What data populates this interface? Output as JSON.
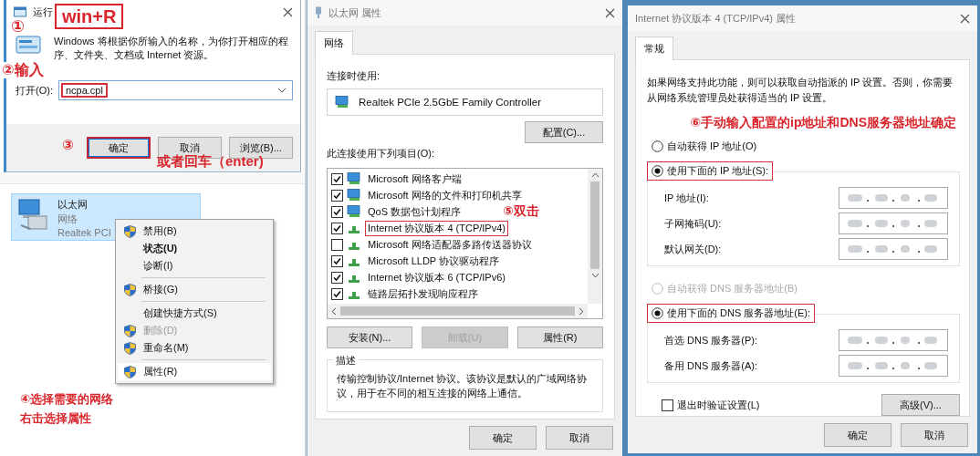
{
  "run_dialog": {
    "title": "运行",
    "description": "Windows 将根据你所输入的名称，为你打开相应的程序、文件夹、文档或 Internet 资源。",
    "open_label": "打开(O):",
    "open_value": "ncpa.cpl",
    "value_highlighted": true,
    "buttons": [
      {
        "label": "确定",
        "highlighted": true
      },
      {
        "label": "取消",
        "highlighted": false
      },
      {
        "label": "浏览(B)...",
        "highlighted": false
      }
    ]
  },
  "network_connection": {
    "name": "以太网",
    "type": "网络",
    "adapter": "Realtek PCI",
    "selected": true
  },
  "context_menu": [
    {
      "kind": "shield",
      "label": "禁用(B)",
      "bold": false,
      "disabled": false,
      "selected": false
    },
    {
      "kind": "plain",
      "label": "状态(U)",
      "bold": true,
      "disabled": false,
      "selected": false
    },
    {
      "kind": "plain",
      "label": "诊断(I)",
      "bold": false,
      "disabled": false,
      "selected": false
    },
    {
      "kind": "separator"
    },
    {
      "kind": "shield",
      "label": "桥接(G)",
      "bold": false,
      "disabled": false,
      "selected": false
    },
    {
      "kind": "separator"
    },
    {
      "kind": "plain",
      "label": "创建快捷方式(S)",
      "bold": false,
      "disabled": false,
      "selected": false
    },
    {
      "kind": "shield",
      "label": "删除(D)",
      "bold": false,
      "disabled": true,
      "selected": false
    },
    {
      "kind": "shield",
      "label": "重命名(M)",
      "bold": false,
      "disabled": false,
      "selected": false
    },
    {
      "kind": "separator"
    },
    {
      "kind": "shield",
      "label": "属性(R)",
      "bold": false,
      "disabled": false,
      "selected": true
    }
  ],
  "annotations": {
    "step1": "①",
    "shortcut": "win+R",
    "step2": "②输入",
    "step3": "③",
    "enter_hint": "或者回车（enter)",
    "step4": [
      "④选择需要的网络",
      "右击选择属性"
    ],
    "step5": "⑤双击",
    "step6": "⑥手动输入配置的ip地址和DNS服务器地址确定"
  },
  "ethernet_properties": {
    "title": "以太网 属性",
    "tabs": [
      {
        "label": "网络",
        "selected": true
      }
    ],
    "connect_using_label": "连接时使用:",
    "adapter": "Realtek PCIe 2.5GbE Family Controller",
    "configure_button": "配置(C)...",
    "items_label": "此连接使用下列项目(O):",
    "items": [
      {
        "kind": "client",
        "label": "Microsoft 网络客户端",
        "checked": true,
        "highlighted": false
      },
      {
        "kind": "client",
        "label": "Microsoft 网络的文件和打印机共享",
        "checked": true,
        "highlighted": false
      },
      {
        "kind": "client",
        "label": "QoS 数据包计划程序",
        "checked": true,
        "highlighted": false
      },
      {
        "kind": "protocol",
        "label": "Internet 协议版本 4 (TCP/IPv4)",
        "checked": true,
        "highlighted": true
      },
      {
        "kind": "protocol",
        "label": "Microsoft 网络适配器多路传送器协议",
        "checked": false,
        "highlighted": false
      },
      {
        "kind": "protocol",
        "label": "Microsoft LLDP 协议驱动程序",
        "checked": true,
        "highlighted": false
      },
      {
        "kind": "protocol",
        "label": "Internet 协议版本 6 (TCP/IPv6)",
        "checked": true,
        "highlighted": false
      },
      {
        "kind": "protocol",
        "label": "链路层拓扑发现响应程序",
        "checked": true,
        "highlighted": false
      }
    ],
    "buttons": [
      {
        "label": "安装(N)...",
        "disabled": false
      },
      {
        "label": "卸载(U)",
        "disabled": true
      },
      {
        "label": "属性(R)",
        "disabled": false
      }
    ],
    "description_title": "描述",
    "description": "传输控制协议/Internet 协议。该协议是默认的广域网络协议，用于在不同的相互连接的网络上通信。",
    "footer_buttons": [
      "确定",
      "取消"
    ]
  },
  "ipv4_properties": {
    "title": "Internet 协议版本 4 (TCP/IPv4) 属性",
    "tabs": [
      {
        "label": "常规",
        "selected": true
      }
    ],
    "intro": "如果网络支持此功能，则可以获取自动指派的 IP 设置。否则，你需要从网络系统管理员处获得适当的 IP 设置。",
    "ip_mode": [
      {
        "label": "自动获得 IP 地址(O)",
        "selected": false,
        "disabled": false,
        "highlighted": false
      },
      {
        "label": "使用下面的 IP 地址(S):",
        "selected": true,
        "disabled": false,
        "highlighted": true
      }
    ],
    "ip_fields": [
      {
        "label": "IP 地址(I):"
      },
      {
        "label": "子网掩码(U):"
      },
      {
        "label": "默认网关(D):"
      }
    ],
    "dns_mode": [
      {
        "label": "自动获得 DNS 服务器地址(B)",
        "selected": false,
        "disabled": true,
        "highlighted": false
      },
      {
        "label": "使用下面的 DNS 服务器地址(E):",
        "selected": true,
        "disabled": false,
        "highlighted": true
      }
    ],
    "dns_fields": [
      {
        "label": "首选 DNS 服务器(P):"
      },
      {
        "label": "备用 DNS 服务器(A):"
      }
    ],
    "validate_on_exit": {
      "label": "退出时验证设置(L)",
      "checked": false
    },
    "advanced_button": "高级(V)...",
    "footer_buttons": [
      "确定",
      "取消"
    ]
  }
}
